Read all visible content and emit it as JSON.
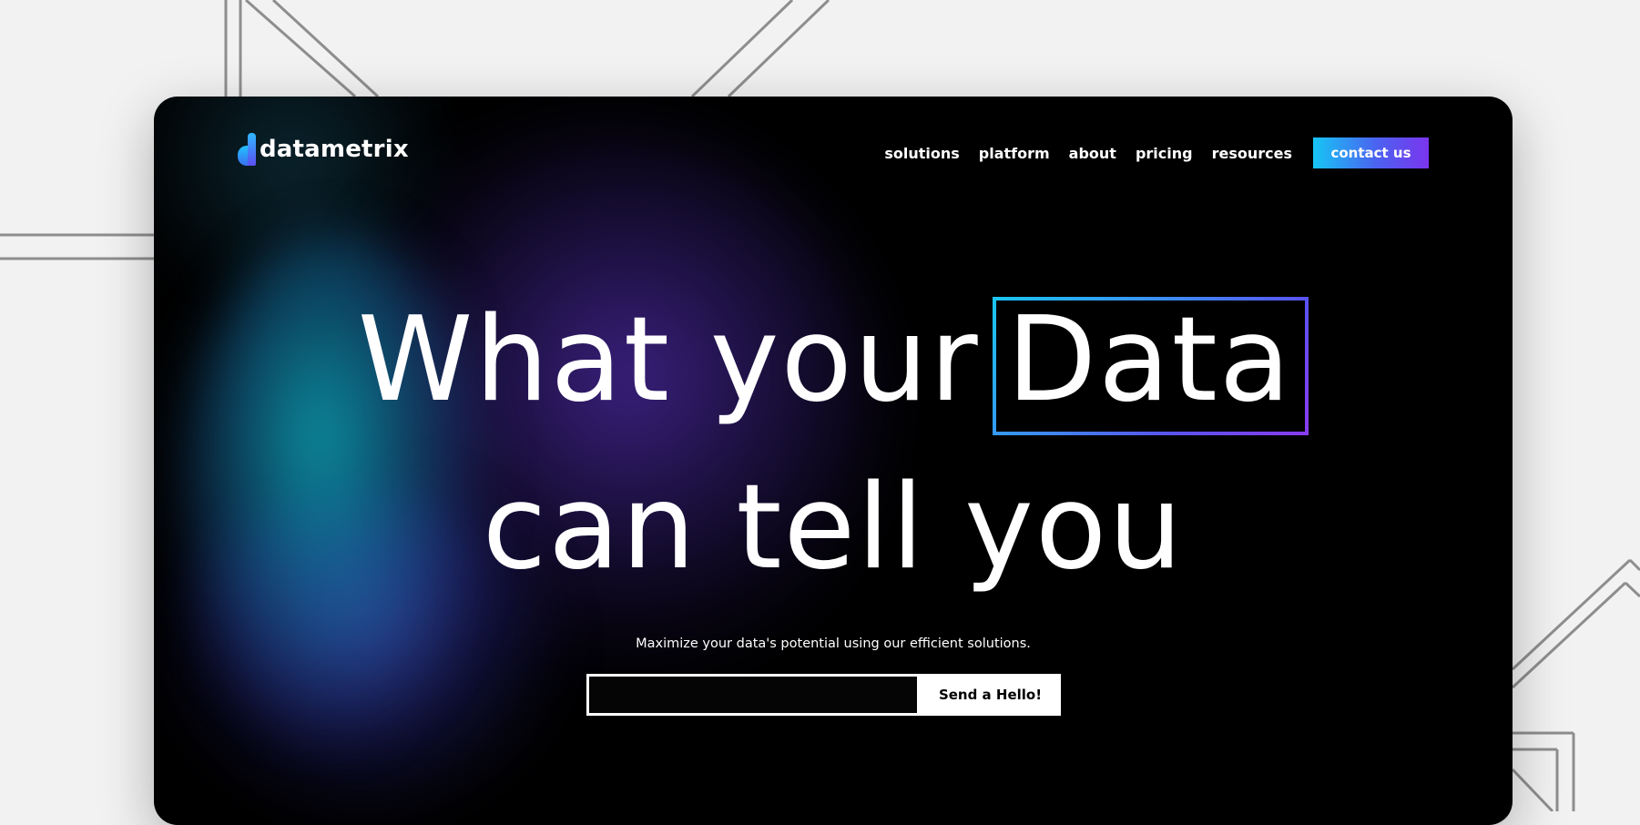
{
  "brand": {
    "name": "datametrix",
    "logo_icon": "d-bar-logo-icon"
  },
  "nav": {
    "links": [
      "solutions",
      "platform",
      "about",
      "pricing",
      "resources"
    ],
    "cta_label": "contact us"
  },
  "hero": {
    "line1_prefix": "What your",
    "line1_highlight": "Data",
    "line2": "can tell you",
    "tagline": "Maximize your data's potential using our efficient solutions."
  },
  "signup": {
    "input_value": "",
    "input_placeholder": "",
    "button_label": "Send a Hello!"
  },
  "colors": {
    "page_background": "#f2f2f3",
    "window_background": "#000000",
    "accent_cyan": "#16c6f5",
    "accent_blue": "#4b62f0",
    "accent_purple": "#7b35ee",
    "text": "#ffffff",
    "decor_lines": "#8e8e8e"
  }
}
